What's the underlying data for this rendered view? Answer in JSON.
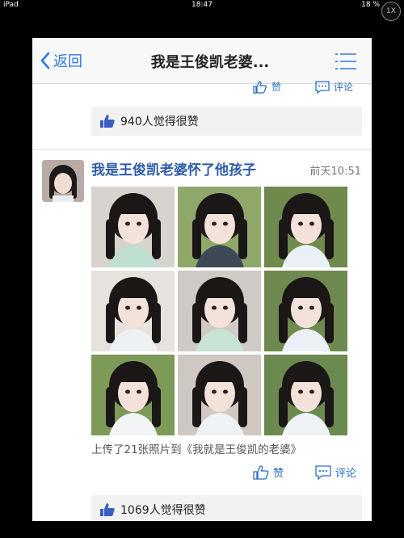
{
  "status": {
    "device": "iPad",
    "time": "18:47",
    "battery": "18 %",
    "zoom": "1X"
  },
  "nav": {
    "back": "返回",
    "title": "我是王俊凯老婆..."
  },
  "prev_post": {
    "like_action": "赞",
    "comment_action": "评论",
    "likes_text": "940人觉得很赞"
  },
  "post": {
    "title": "我是王俊凯老婆怀了他孩子",
    "time": "前天10:51",
    "photos": [
      "photo-1",
      "photo-2",
      "photo-3",
      "photo-4",
      "photo-5",
      "photo-6",
      "photo-7",
      "photo-8",
      "photo-9"
    ],
    "description": "上传了21张照片到《我就是王俊凯的老婆》",
    "like_action": "赞",
    "comment_action": "评论",
    "likes_text": "1069人觉得很赞"
  },
  "colors": {
    "accent": "#2a7ae2",
    "title_blue": "#2d5ca8",
    "like_blue": "#3b5fbf"
  },
  "icons": [
    "back-chevron-icon",
    "menu-list-icon",
    "thumbs-up-icon",
    "comment-icon"
  ]
}
